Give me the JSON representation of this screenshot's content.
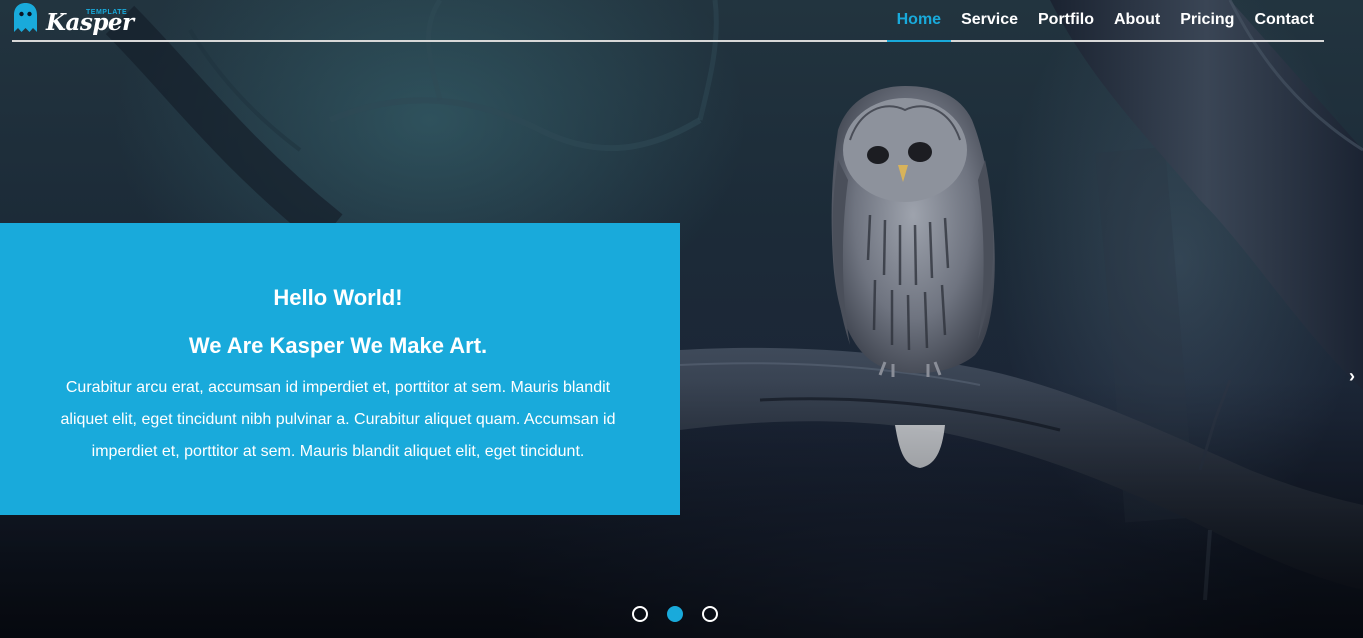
{
  "brand": {
    "name": "Kasper",
    "tagline": "TEMPLATE",
    "icon": "ghost-icon",
    "accent_color": "#19aadb"
  },
  "nav": {
    "items": [
      {
        "label": "Home",
        "active": true
      },
      {
        "label": "Service",
        "active": false
      },
      {
        "label": "Portfilo",
        "active": false
      },
      {
        "label": "About",
        "active": false
      },
      {
        "label": "Pricing",
        "active": false
      },
      {
        "label": "Contact",
        "active": false
      }
    ]
  },
  "hero": {
    "title": "Hello World!",
    "subtitle": "We Are Kasper We Make Art.",
    "text": "Curabitur arcu erat, accumsan id imperdiet et, porttitor at sem. Mauris blandit aliquet elit, eget tincidunt nibh pulvinar a. Curabitur aliquet quam. Accumsan id imperdiet et, porttitor at sem. Mauris blandit aliquet elit, eget tincidunt.",
    "prev_icon": "chevron-left-icon",
    "next_icon": "chevron-right-icon",
    "prev_glyph": "‹",
    "next_glyph": "›"
  },
  "slider": {
    "dots": 3,
    "active_index": 1
  }
}
